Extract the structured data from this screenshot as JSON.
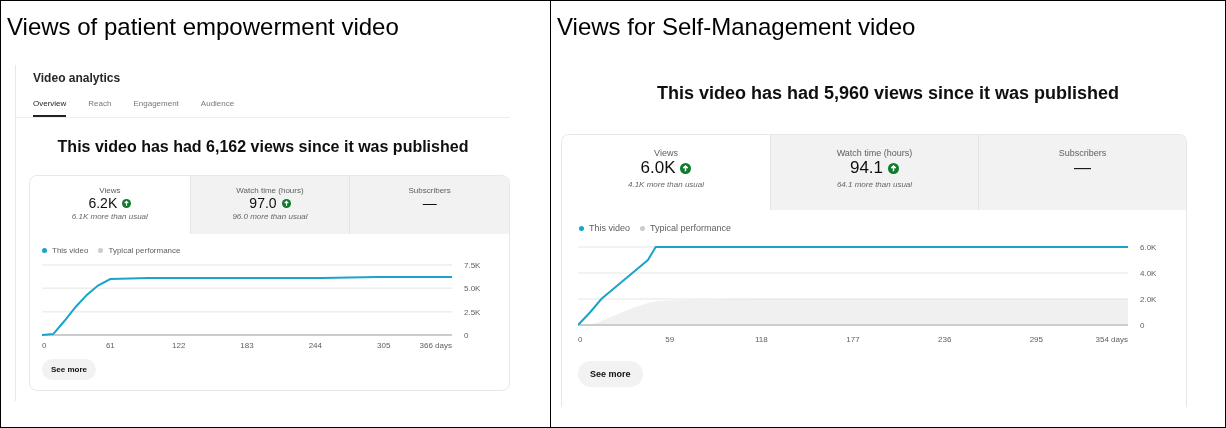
{
  "panels": [
    {
      "heading": "Views of patient empowerment video",
      "studio": {
        "title": "Video analytics",
        "tabs": [
          {
            "label": "Overview",
            "selected": true
          },
          {
            "label": "Reach",
            "selected": false
          },
          {
            "label": "Engagement",
            "selected": false
          },
          {
            "label": "Audience",
            "selected": false
          }
        ]
      },
      "summary": "This video has had 6,162 views since it was published",
      "metrics": [
        {
          "label": "Views",
          "value": "6.2K",
          "trend_up": true,
          "note": "6.1K more than usual",
          "selected": true
        },
        {
          "label": "Watch time (hours)",
          "value": "97.0",
          "trend_up": true,
          "note": "96.0 more than usual",
          "selected": false
        },
        {
          "label": "Subscribers",
          "value": "—",
          "trend_up": false,
          "selected": false
        }
      ],
      "chart_data": {
        "type": "line",
        "x": [
          0,
          10,
          20,
          30,
          40,
          50,
          61,
          95,
          150,
          200,
          250,
          300,
          366
        ],
        "xlim": [
          0,
          366
        ],
        "ylim": [
          0,
          7500
        ],
        "xticks": [
          0,
          61,
          122,
          183,
          244,
          305,
          {
            "value": 366,
            "label": "366 days"
          }
        ],
        "yticks": [
          0,
          {
            "value": 2500,
            "label": "2.5K"
          },
          {
            "value": 5000,
            "label": "5.0K"
          },
          {
            "value": 7500,
            "label": "7.5K"
          }
        ],
        "series": [
          {
            "name": "This video",
            "type": "line",
            "color": "#1aa3cc",
            "values": [
              0,
              100,
              1500,
              3000,
              4300,
              5300,
              6000,
              6100,
              6100,
              6100,
              6100,
              6200,
              6200
            ]
          },
          {
            "name": "Typical performance",
            "type": "area",
            "color": "#cccccc",
            "values": [
              null,
              null,
              null,
              null,
              null,
              null,
              null,
              null,
              null,
              null,
              null,
              null,
              null
            ]
          }
        ]
      },
      "button": "See more"
    },
    {
      "heading": "Views for Self-Management video",
      "summary": "This video has had 5,960 views since it was published",
      "metrics": [
        {
          "label": "Views",
          "value": "6.0K",
          "trend_up": true,
          "note": "4.1K more than usual",
          "selected": true
        },
        {
          "label": "Watch time (hours)",
          "value": "94.1",
          "trend_up": true,
          "note": "64.1 more than usual",
          "selected": false
        },
        {
          "label": "Subscribers",
          "value": "—",
          "trend_up": false,
          "selected": false
        }
      ],
      "chart_data": {
        "type": "line",
        "x": [
          0,
          8,
          15,
          25,
          35,
          45,
          50,
          59,
          118,
          177,
          236,
          295,
          354
        ],
        "xlim": [
          0,
          354
        ],
        "ylim": [
          0,
          6000
        ],
        "xticks": [
          0,
          59,
          118,
          177,
          236,
          295,
          {
            "value": 354,
            "label": "354 days"
          }
        ],
        "yticks": [
          0,
          {
            "value": 2000,
            "label": "2.0K"
          },
          {
            "value": 4000,
            "label": "4.0K"
          },
          {
            "value": 6000,
            "label": "6.0K"
          }
        ],
        "series": [
          {
            "name": "This video",
            "type": "line",
            "color": "#1aa3cc",
            "values": [
              0,
              1000,
              2000,
              3000,
              4000,
              5000,
              6000,
              6000,
              6000,
              6000,
              6000,
              6000,
              6000
            ]
          },
          {
            "name": "Typical performance",
            "type": "area",
            "color": "#cccccc",
            "values": [
              0,
              0,
              300,
              800,
              1300,
              1700,
              1800,
              1900,
              2000,
              2000,
              2000,
              2000,
              2000
            ]
          }
        ]
      },
      "button": "See more"
    }
  ]
}
